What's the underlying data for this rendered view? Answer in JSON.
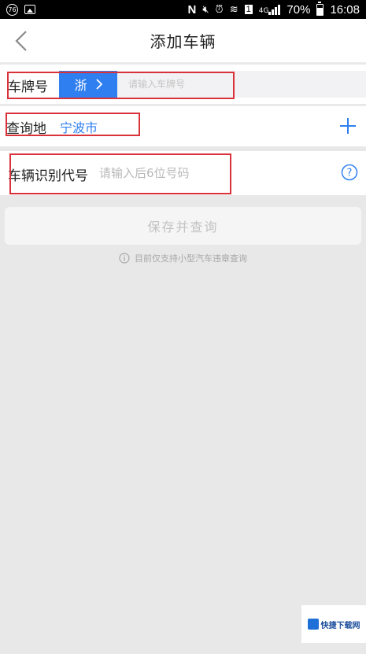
{
  "status_bar": {
    "circle_badge": "76",
    "battery_percent": "70%",
    "time": "16:08",
    "network": "4G",
    "nfc_letter": "N",
    "sim_letter": "1"
  },
  "header": {
    "title": "添加车辆"
  },
  "plate_row": {
    "label": "车牌号",
    "province": "浙",
    "placeholder": "请输入车牌号"
  },
  "city_row": {
    "label": "查询地",
    "value": "宁波市"
  },
  "vin_row": {
    "label": "车辆识别代号",
    "placeholder": "请输入后6位号码"
  },
  "save_button": {
    "label": "保存并查询"
  },
  "notice": {
    "text": "目前仅支持小型汽车违章查询"
  },
  "watermark": {
    "text": "快捷下载网"
  },
  "colors": {
    "accent": "#2f7ff0",
    "highlight": "#d9323a",
    "background": "#e8e8e8"
  }
}
